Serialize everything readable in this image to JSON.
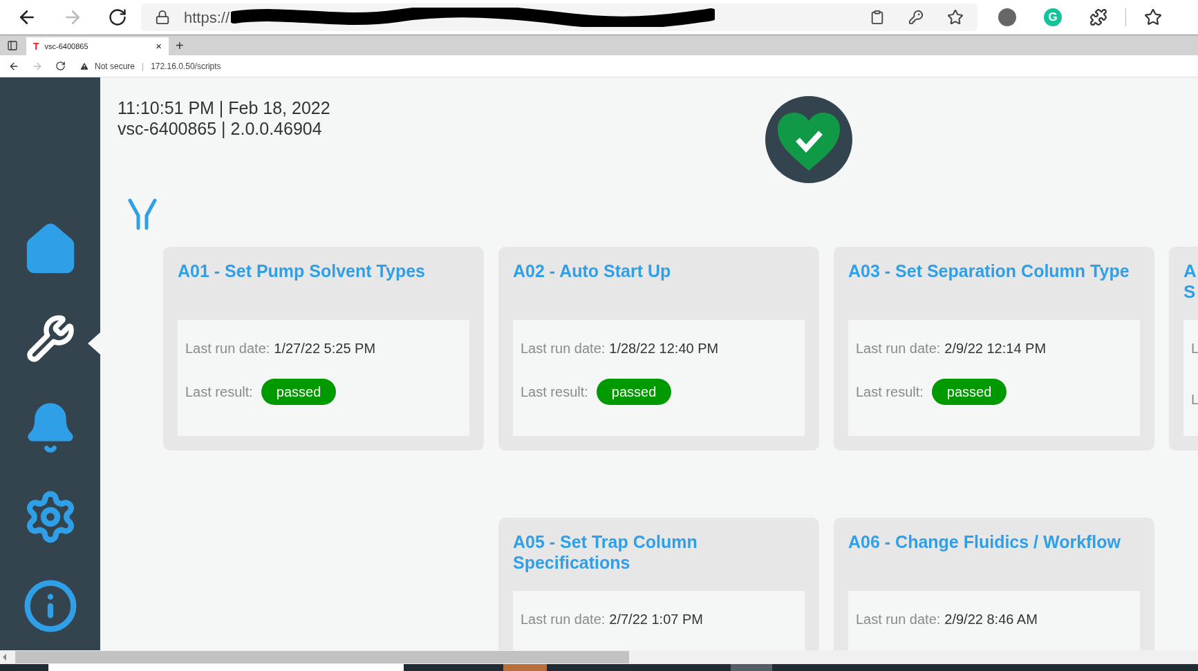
{
  "outer_browser": {
    "address": "https://",
    "extension_badge": "G"
  },
  "inner_browser": {
    "tab": {
      "favicon": "T",
      "title": "vsc-6400865",
      "close": "×",
      "selected": true
    },
    "new_tab": "+",
    "security": "Not secure",
    "separator": "|",
    "address": "172.16.0.50/scripts"
  },
  "header": {
    "datetime": "11:10:51 PM | Feb 18, 2022",
    "device": "vsc-6400865 | 2.0.0.46904"
  },
  "sidebar": {
    "items": [
      {
        "kind": "home",
        "selected": false
      },
      {
        "kind": "tools",
        "selected": true
      },
      {
        "kind": "alerts",
        "selected": false
      },
      {
        "kind": "settings",
        "selected": false
      },
      {
        "kind": "info",
        "selected": false
      }
    ]
  },
  "card_rows": [
    {
      "cards": [
        {
          "kind": "full",
          "title": "A01 - Set Pump Solvent Types",
          "date_label": "Last run date:",
          "date": "1/27/22 5:25 PM",
          "result_label": "Last result:",
          "result": "passed"
        },
        {
          "kind": "full",
          "title": "A02 - Auto Start Up",
          "date_label": "Last run date:",
          "date": "1/28/22 12:40 PM",
          "result_label": "Last result:",
          "result": "passed"
        },
        {
          "kind": "full",
          "title": "A03 - Set Separation Column Type",
          "date_label": "Last run date:",
          "date": "2/9/22 12:14 PM",
          "result_label": "Last result:",
          "result": "passed"
        },
        {
          "kind": "clipped",
          "title_lines": [
            "A",
            "S"
          ],
          "label_lines": [
            "L",
            "L"
          ]
        }
      ]
    },
    {
      "cards": [
        {
          "kind": "full",
          "title": "A05 - Set Trap Column Specifications",
          "date_label": "Last run date:",
          "date": "2/7/22 1:07 PM"
        },
        {
          "kind": "full",
          "title": "A06 - Change Fluidics / Workflow",
          "date_label": "Last run date:",
          "date": "2/9/22 8:46 AM"
        }
      ]
    }
  ]
}
